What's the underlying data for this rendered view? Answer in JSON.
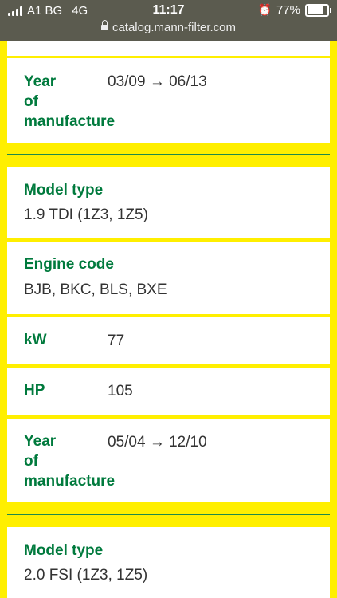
{
  "status_bar": {
    "carrier": "A1 BG",
    "network": "4G",
    "time": "11:17",
    "battery": "77%"
  },
  "url_bar": {
    "domain": "catalog.mann-filter.com"
  },
  "vehicle_prev": {
    "year_label": "Year\nof\nmanufacture",
    "year_value": "03/09 → 06/13"
  },
  "vehicle_1": {
    "model_type_label": "Model type",
    "model_type_value": "1.9 TDI (1Z3, 1Z5)",
    "engine_code_label": "Engine code",
    "engine_code_value": "BJB, BKC, BLS, BXE",
    "kw_label": "kW",
    "kw_value": "77",
    "hp_label": "HP",
    "hp_value": "105",
    "year_label": "Year\nof\nmanufacture",
    "year_value": "05/04 → 12/10"
  },
  "vehicle_2": {
    "model_type_label": "Model type",
    "model_type_value": "2.0 FSI (1Z3, 1Z5)"
  }
}
